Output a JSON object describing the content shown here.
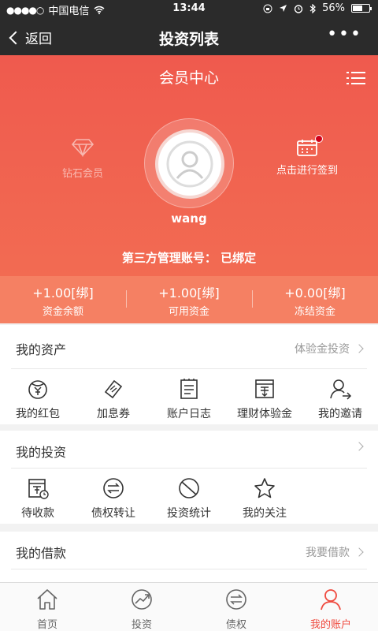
{
  "status": {
    "signal": "●●●●○",
    "carrier": "中国电信",
    "time": "13:44",
    "battery": "56%"
  },
  "nav": {
    "back_label": "返回",
    "title": "投资列表"
  },
  "hero": {
    "title": "会员中心",
    "level_label": "钻石会员",
    "signin_label": "点击进行签到",
    "username": "wang",
    "account_status": "第三方管理账号：  已绑定"
  },
  "balances": [
    {
      "value": "+1.00[绑]",
      "label": "资金余额"
    },
    {
      "value": "+1.00[绑]",
      "label": "可用资金"
    },
    {
      "value": "+0.00[绑]",
      "label": "冻结资金"
    }
  ],
  "assets": {
    "title": "我的资产",
    "link": "体验金投资",
    "items": [
      {
        "label": "我的红包",
        "icon": "red-packet-icon"
      },
      {
        "label": "加息券",
        "icon": "coupon-icon"
      },
      {
        "label": "账户日志",
        "icon": "log-icon"
      },
      {
        "label": "理财体验金",
        "icon": "trial-fund-icon"
      },
      {
        "label": "我的邀请",
        "icon": "invite-icon"
      }
    ]
  },
  "investments": {
    "title": "我的投资",
    "link": "",
    "items": [
      {
        "label": "待收款",
        "icon": "receivable-icon"
      },
      {
        "label": "债权转让",
        "icon": "transfer-icon"
      },
      {
        "label": "投资统计",
        "icon": "statistics-icon"
      },
      {
        "label": "我的关注",
        "icon": "star-icon"
      }
    ]
  },
  "loans": {
    "title": "我的借款",
    "link": "我要借款"
  },
  "tabs": [
    {
      "label": "首页",
      "icon": "home-icon"
    },
    {
      "label": "投资",
      "icon": "invest-icon"
    },
    {
      "label": "债权",
      "icon": "debt-icon"
    },
    {
      "label": "我的账户",
      "icon": "account-icon",
      "active": true
    }
  ],
  "colors": {
    "accent": "#ef5a4e",
    "active_tab": "#ef4a3f",
    "balance_bar": "#f58063",
    "dark_bar": "#2b2b2b"
  }
}
